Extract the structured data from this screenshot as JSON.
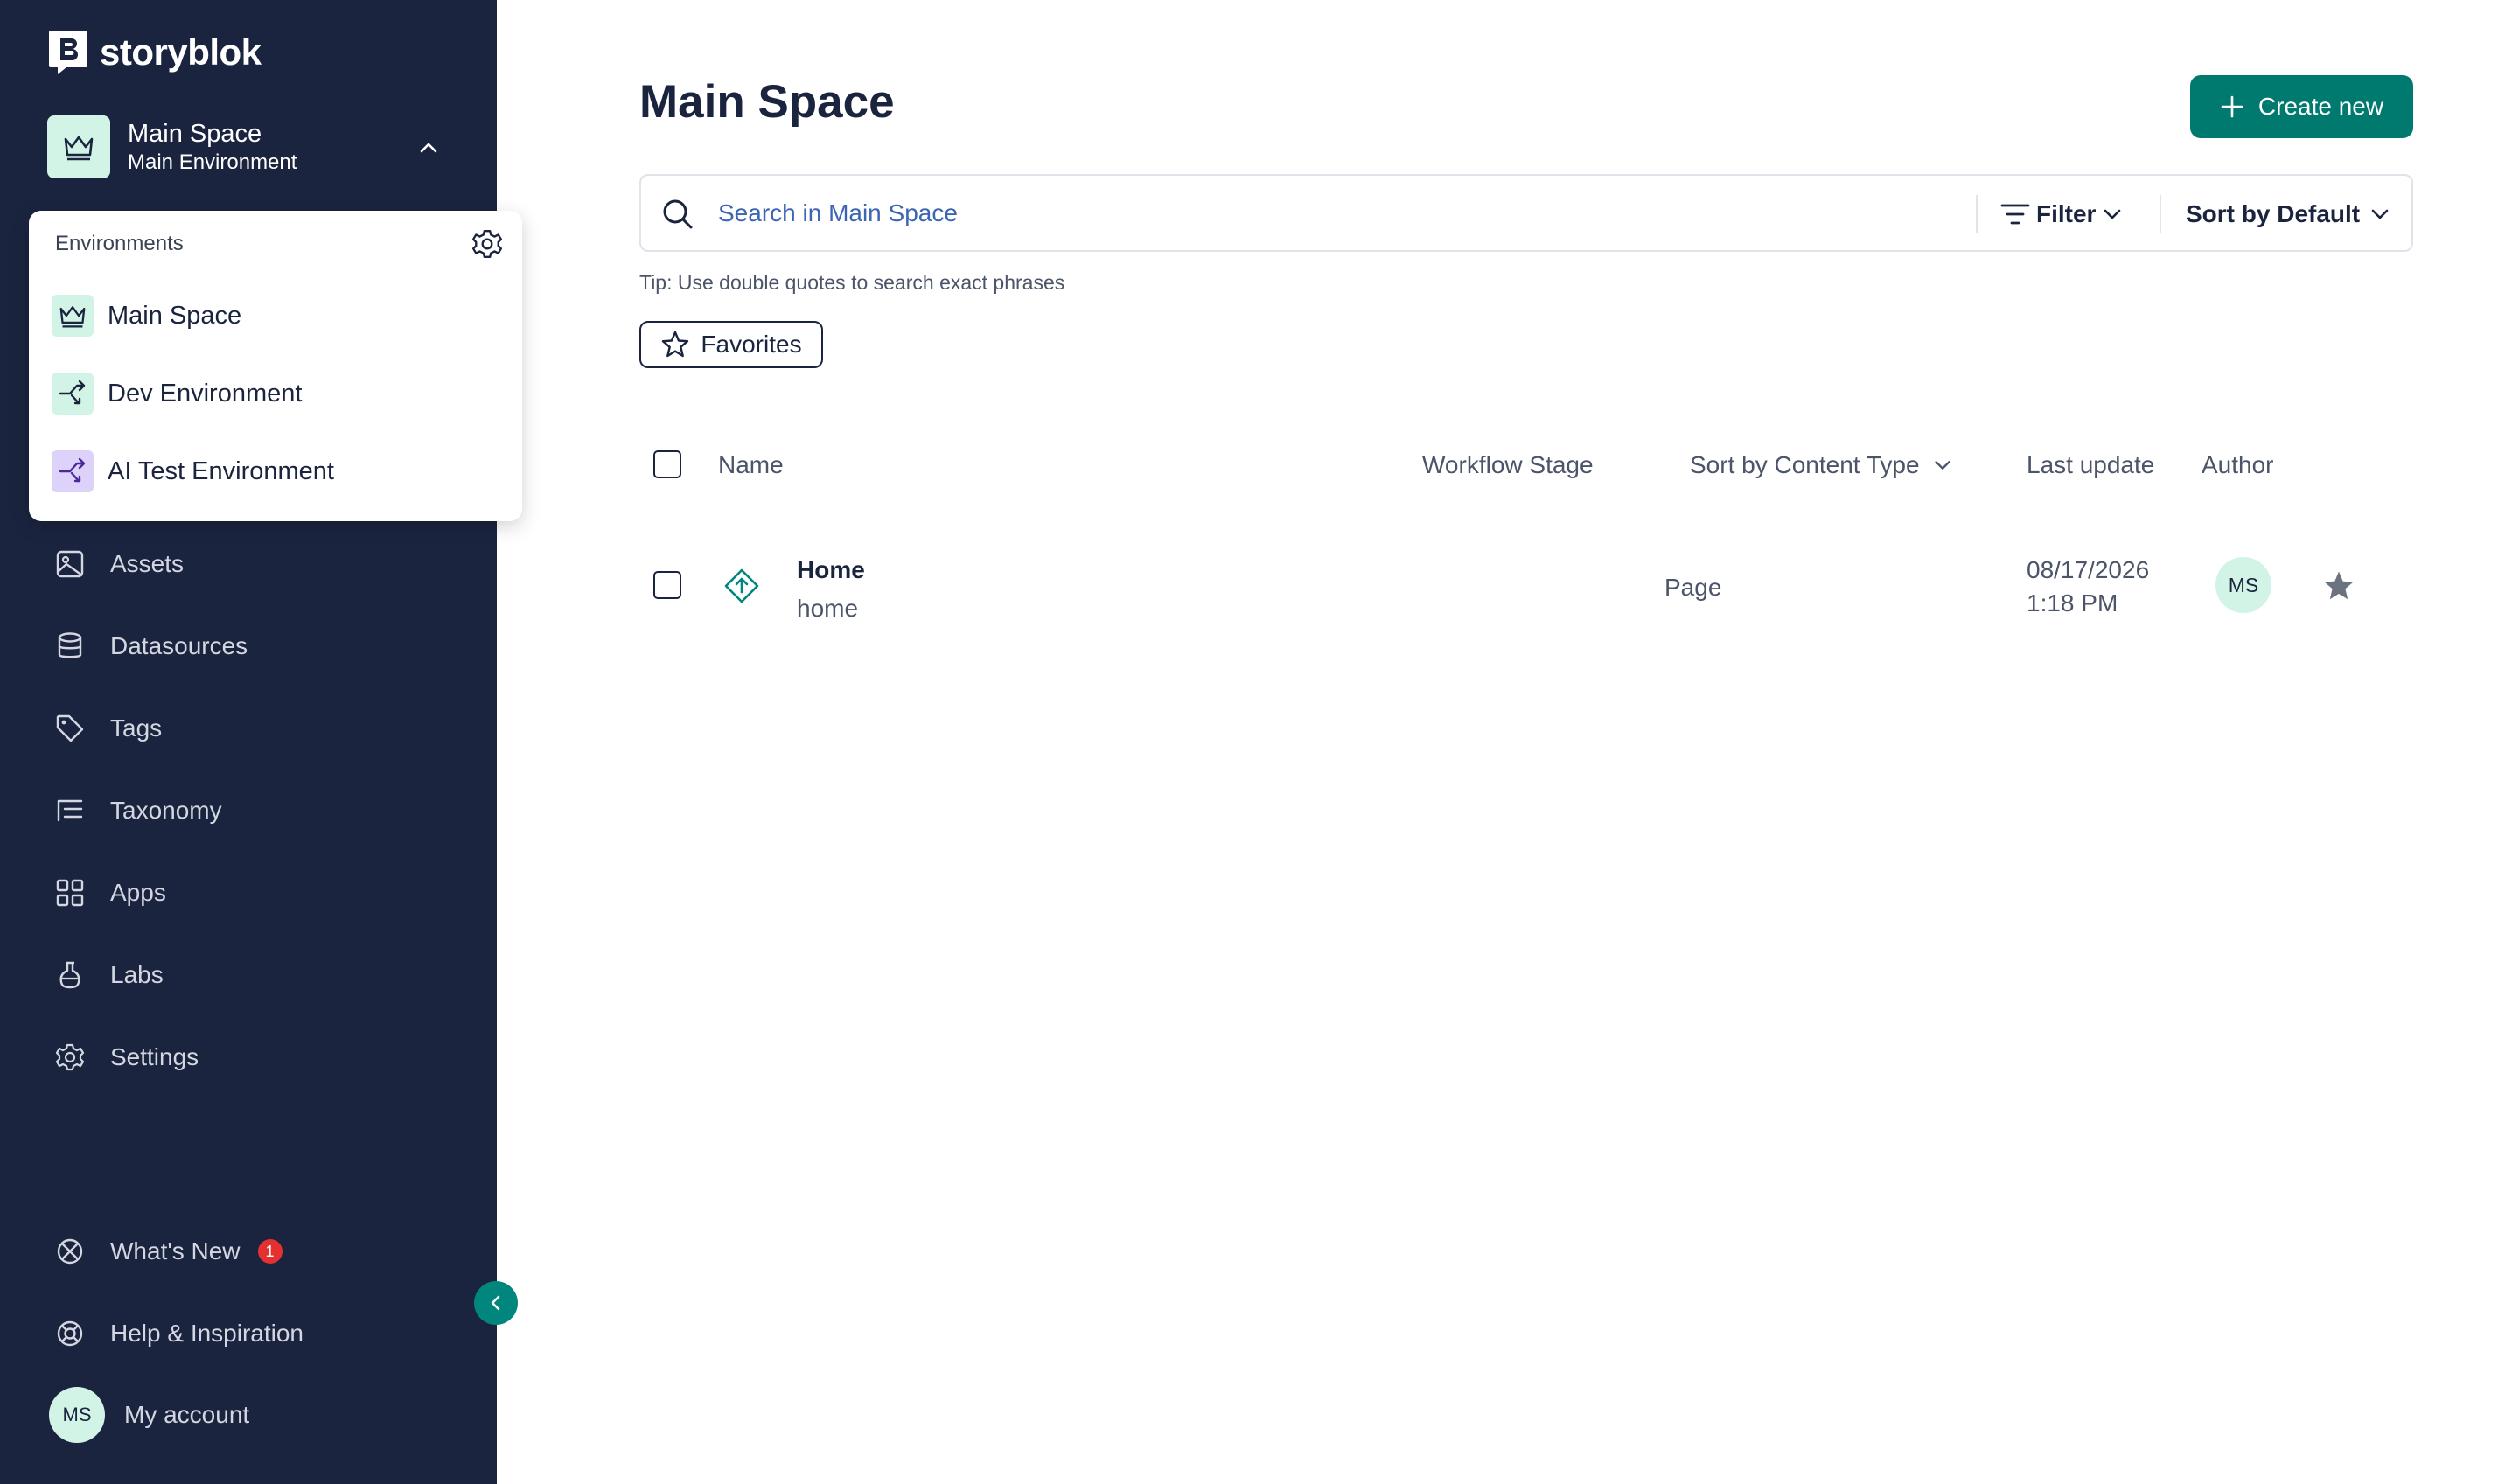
{
  "brand": {
    "name": "storyblok"
  },
  "space": {
    "name": "Main Space",
    "environment": "Main Environment"
  },
  "environments": {
    "title": "Environments",
    "items": [
      {
        "label": "Main Space",
        "icon": "crown-icon",
        "color": "#d2f4e6"
      },
      {
        "label": "Dev Environment",
        "icon": "branch-icon",
        "color": "#d2f4e6"
      },
      {
        "label": "AI Test Environment",
        "icon": "branch-icon",
        "color": "#dcd2fa"
      }
    ]
  },
  "nav": {
    "items": [
      {
        "label": "Assets",
        "icon": "image-icon"
      },
      {
        "label": "Datasources",
        "icon": "database-icon"
      },
      {
        "label": "Tags",
        "icon": "tag-icon"
      },
      {
        "label": "Taxonomy",
        "icon": "taxonomy-icon"
      },
      {
        "label": "Apps",
        "icon": "apps-icon"
      },
      {
        "label": "Labs",
        "icon": "flask-icon"
      },
      {
        "label": "Settings",
        "icon": "gear-icon"
      }
    ],
    "whats_new": {
      "label": "What's New",
      "badge": "1"
    },
    "help": {
      "label": "Help & Inspiration"
    },
    "account": {
      "label": "My account",
      "initials": "MS"
    }
  },
  "main": {
    "title": "Main Space",
    "create_label": "Create new",
    "search": {
      "placeholder": "Search in Main Space",
      "value": ""
    },
    "filter_label": "Filter",
    "sort_label": "Sort by Default",
    "tip": "Tip: Use double quotes to search exact phrases",
    "favorites_label": "Favorites"
  },
  "table": {
    "headers": {
      "name": "Name",
      "workflow": "Workflow Stage",
      "content_type": "Sort by Content Type",
      "last_update": "Last update",
      "author": "Author"
    },
    "rows": [
      {
        "name": "Home",
        "slug": "home",
        "content_type": "Page",
        "date": "08/17/2026",
        "time": "1:18 PM",
        "author_initials": "MS"
      }
    ]
  },
  "colors": {
    "sidebar": "#1b243f",
    "accent": "#00796e",
    "badge": "#e53030"
  }
}
